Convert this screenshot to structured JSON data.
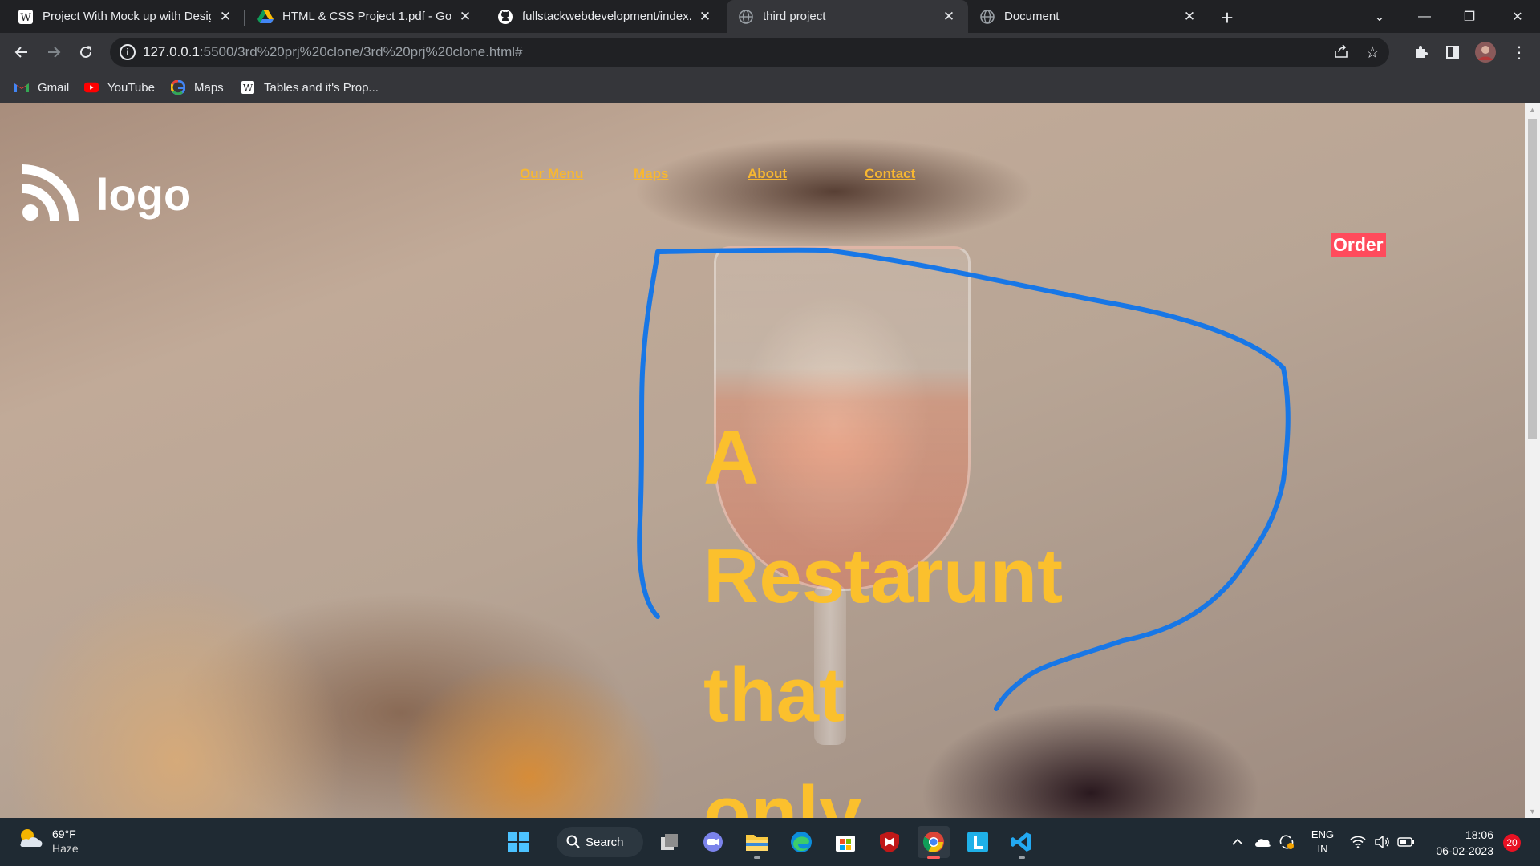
{
  "browser": {
    "tabs": [
      {
        "title": "Project With Mock up with Desig",
        "icon": "wp-icon",
        "active": false
      },
      {
        "title": "HTML & CSS Project 1.pdf - Goo",
        "icon": "google-drive-icon",
        "active": false
      },
      {
        "title": "fullstackwebdevelopment/index.",
        "icon": "github-icon",
        "active": false
      },
      {
        "title": "third project",
        "icon": "globe-icon",
        "active": true
      },
      {
        "title": "Document",
        "icon": "globe-icon",
        "active": false
      }
    ],
    "address": {
      "host": "127.0.0.1",
      "path": ":5500/3rd%20prj%20clone/3rd%20prj%20clone.html#"
    },
    "bookmarks": [
      {
        "label": "Gmail",
        "icon": "gmail-icon"
      },
      {
        "label": "YouTube",
        "icon": "youtube-icon"
      },
      {
        "label": "Maps",
        "icon": "google-icon"
      },
      {
        "label": "Tables and it's Prop...",
        "icon": "wp-icon"
      }
    ]
  },
  "site": {
    "logo_text": "logo",
    "nav": [
      "Our Menu",
      "Maps",
      "About",
      "Contact"
    ],
    "order_label": "Order",
    "hero_words": [
      "A",
      "Restarunt",
      "that",
      "only"
    ],
    "colors": {
      "nav": "#f7b731",
      "hero": "#fbc02d",
      "order_bg": "#ff4b5c",
      "annotation": "#1877e6"
    }
  },
  "taskbar": {
    "weather": {
      "temp": "69°F",
      "condition": "Haze"
    },
    "search_label": "Search",
    "apps": [
      "start-icon",
      "search-icon",
      "task-view-icon",
      "chat-icon",
      "file-explorer-icon",
      "edge-icon",
      "store-icon",
      "mcafee-icon",
      "chrome-icon",
      "l-app-icon",
      "vscode-icon"
    ],
    "tray": {
      "lang_top": "ENG",
      "lang_bottom": "IN"
    },
    "clock": {
      "time": "18:06",
      "date": "06-02-2023"
    },
    "notifications": "20"
  }
}
